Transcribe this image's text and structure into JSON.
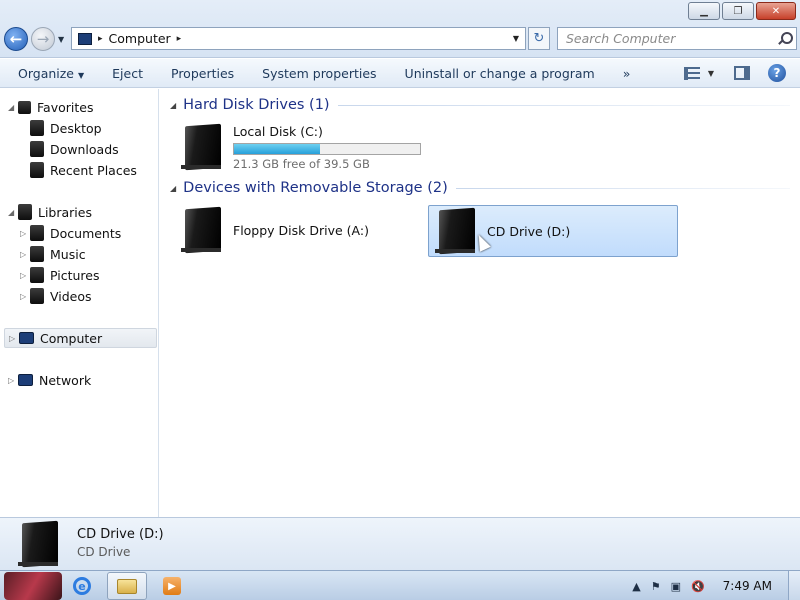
{
  "window": {
    "minimize_glyph": "▁",
    "restore_glyph": "❐",
    "close_glyph": "✕"
  },
  "navigation": {
    "back_glyph": "←",
    "forward_glyph": "→",
    "address": {
      "crumb": "Computer",
      "separator": "▸"
    },
    "refresh_glyph": "↻",
    "search_placeholder": "Search Computer"
  },
  "toolbar": {
    "items": [
      {
        "label": "Organize",
        "has_caret": true
      },
      {
        "label": "Eject"
      },
      {
        "label": "Properties"
      },
      {
        "label": "System properties"
      },
      {
        "label": "Uninstall or change a program"
      },
      {
        "label": "»"
      }
    ]
  },
  "sidebar": {
    "items": [
      {
        "label": "Favorites",
        "level": 0,
        "expander": "◢"
      },
      {
        "label": "Desktop",
        "level": 1
      },
      {
        "label": "Downloads",
        "level": 1
      },
      {
        "label": "Recent Places",
        "level": 1
      },
      {
        "label": "Libraries",
        "level": 0,
        "expander": "◢"
      },
      {
        "label": "Documents",
        "level": 1,
        "expander": "▷"
      },
      {
        "label": "Music",
        "level": 1,
        "expander": "▷"
      },
      {
        "label": "Pictures",
        "level": 1,
        "expander": "▷"
      },
      {
        "label": "Videos",
        "level": 1,
        "expander": "▷"
      },
      {
        "label": "Computer",
        "level": 0,
        "expander": "▷",
        "selected": true
      },
      {
        "label": "Network",
        "level": 0,
        "expander": "▷"
      }
    ]
  },
  "content": {
    "groups": [
      {
        "header": "Hard Disk Drives (1)",
        "drives": [
          {
            "name": "Local Disk (C:)",
            "free_text": "21.3 GB free of 39.5 GB",
            "used_fraction": 0.46
          }
        ]
      },
      {
        "header": "Devices with Removable Storage (2)",
        "drives": [
          {
            "name": "Floppy Disk Drive (A:)"
          },
          {
            "name": "CD Drive (D:)",
            "selected": true
          }
        ]
      }
    ]
  },
  "details": {
    "name": "CD Drive (D:)",
    "type": "CD Drive"
  },
  "taskbar": {
    "ie_glyph": "e",
    "media_glyph": "▶",
    "tray_icons": [
      "▲",
      "⚑",
      "▣",
      "🔇"
    ],
    "clock": "7:49 AM"
  },
  "colors": {
    "group_header": "#1e3287",
    "selection_bg": "#c1dcfc",
    "usage_fill": "#26a0da"
  }
}
